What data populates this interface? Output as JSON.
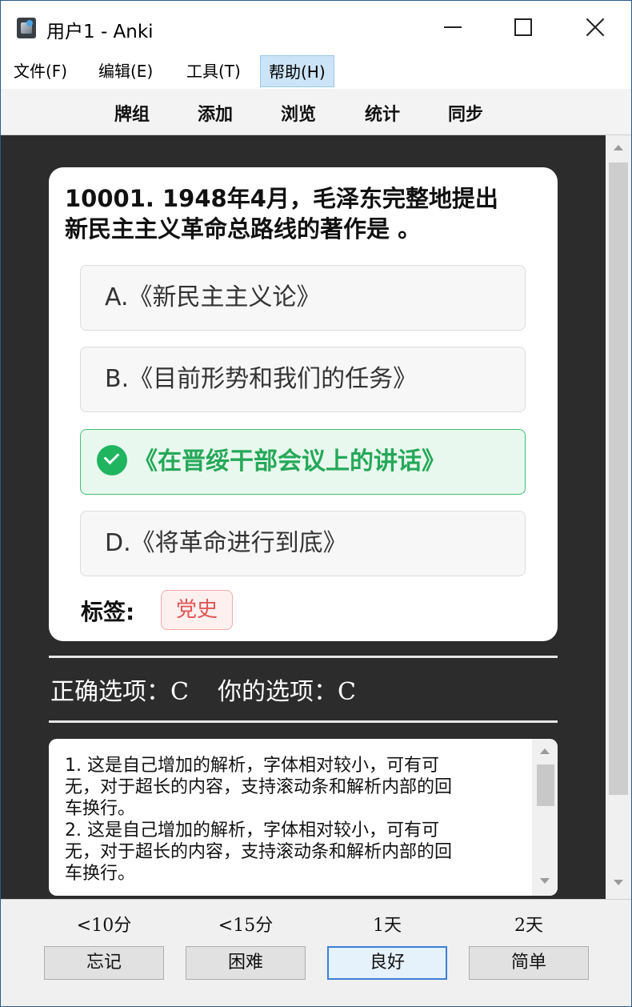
{
  "window": {
    "title": "用户1 - Anki"
  },
  "menu": {
    "items": [
      {
        "label": "文件(F)"
      },
      {
        "label": "编辑(E)"
      },
      {
        "label": "工具(T)"
      },
      {
        "label": "帮助(H)"
      }
    ]
  },
  "toolbar": {
    "items": [
      {
        "label": "牌组"
      },
      {
        "label": "添加"
      },
      {
        "label": "浏览"
      },
      {
        "label": "统计"
      },
      {
        "label": "同步"
      }
    ]
  },
  "card": {
    "question_line1": "10001. 1948年4月，毛泽东完整地提出",
    "question_line2": "新民主主义革命总路线的著作是 。",
    "options": [
      {
        "label": "A.《新民主主义论》"
      },
      {
        "label": "B.《目前形势和我们的任务》"
      },
      {
        "label": "《在晋绥干部会议上的讲话》",
        "correct": true
      },
      {
        "label": "D.《将革命进行到底》"
      }
    ],
    "tags_label": "标签:",
    "tags": [
      "党史"
    ]
  },
  "result": {
    "correct_text": "正确选项：C",
    "yours_text": "你的选项：C"
  },
  "explanation": {
    "lines": [
      "1. 这是自己增加的解析，字体相对较小，可有可",
      "无，对于超长的内容，支持滚动条和解析内部的回",
      "车换行。",
      "2. 这是自己增加的解析，字体相对较小，可有可",
      "无，对于超长的内容，支持滚动条和解析内部的回",
      "车换行。"
    ]
  },
  "answer_bar": {
    "buttons": [
      {
        "interval": "<10分",
        "label": "忘记"
      },
      {
        "interval": "<15分",
        "label": "困难"
      },
      {
        "interval": "1天",
        "label": "良好",
        "focused": true
      },
      {
        "interval": "2天",
        "label": "简单"
      }
    ]
  },
  "colors": {
    "correct_green": "#25a858",
    "tag_red": "#e05555",
    "viewport_bg": "#2c2c2c"
  }
}
